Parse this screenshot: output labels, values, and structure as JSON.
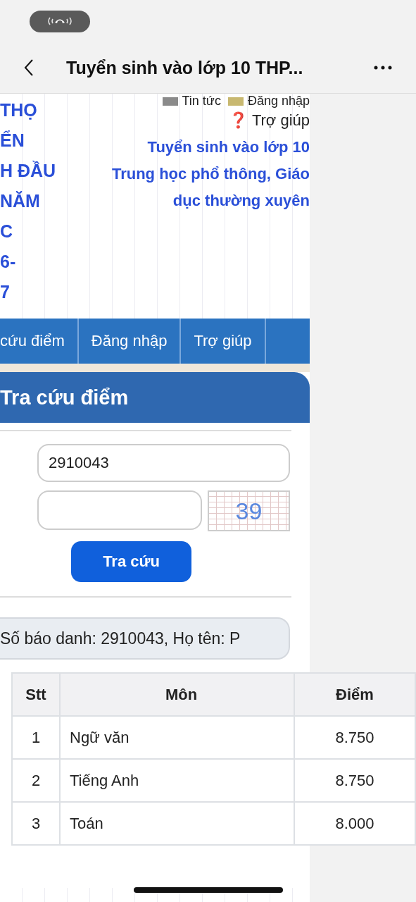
{
  "browser": {
    "title": "Tuyển sinh vào lớp 10 THP..."
  },
  "header": {
    "top_links": [
      {
        "label": "Tin tức",
        "kind": "news"
      },
      {
        "label": "Đăng nhập",
        "kind": "login"
      }
    ],
    "help_link": {
      "icon": "❓",
      "label": "Trợ giúp"
    },
    "left_title_lines": [
      "THỌ",
      "ỂN",
      "H ĐẦU",
      "NĂM",
      "C",
      "6-",
      "7"
    ],
    "title_lines": [
      "Tuyển sinh vào lớp 10",
      "Trung học phổ thông, Giáo",
      "dục thường xuyên"
    ]
  },
  "menu": [
    {
      "label": "cứu điểm",
      "selected": false
    },
    {
      "label": "Đăng nhập",
      "selected": false
    },
    {
      "label": "Trợ giúp",
      "selected": false
    }
  ],
  "panel": {
    "title": "Tra cứu điểm",
    "id_field": {
      "value": "2910043"
    },
    "captcha": "39",
    "button": "Tra cứu",
    "info": "Số báo danh: 2910043, Họ tên: P"
  },
  "table": {
    "columns": [
      "Stt",
      "Môn",
      "Điểm"
    ],
    "rows": [
      [
        "1",
        "Ngữ văn",
        "8.750"
      ],
      [
        "2",
        "Tiếng Anh",
        "8.750"
      ],
      [
        "3",
        "Toán",
        "8.000"
      ]
    ]
  }
}
